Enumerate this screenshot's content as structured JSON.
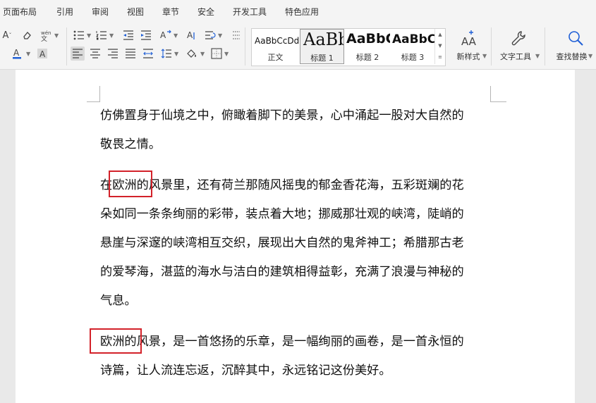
{
  "menu": [
    "页面布局",
    "引用",
    "审阅",
    "视图",
    "章节",
    "安全",
    "开发工具",
    "特色应用"
  ],
  "styles": [
    {
      "sample": "AaBbCcDd",
      "label": "正文"
    },
    {
      "sample": "AaBb",
      "label": "标题 1"
    },
    {
      "sample": "AaBbC",
      "label": "标题 2"
    },
    {
      "sample": "AaBbC",
      "label": "标题 3"
    }
  ],
  "tools": {
    "new_style": "新样式",
    "text_tools": "文字工具",
    "find_replace": "查找替换"
  },
  "document": {
    "paragraphs": [
      [
        "仿佛置身于仙境之中，俯瞰着脚下的美景，心中涌起一股对大自然的",
        "敬畏之情。"
      ],
      [
        "在欧洲的风景里，还有荷兰那随风摇曳的郁金香花海，五彩斑斓的花",
        "朵如同一条条绚丽的彩带，装点着大地；挪威那壮观的峡湾，陡峭的",
        "悬崖与深邃的峡湾相互交织，展现出大自然的鬼斧神工；希腊那古老",
        "的爱琴海，湛蓝的海水与洁白的建筑相得益彰，充满了浪漫与神秘的",
        "气息。"
      ],
      [
        "欧洲的风景，是一首悠扬的乐章，是一幅绚丽的画卷，是一首永恒的",
        "诗篇，让人流连忘返，沉醉其中，永远铭记这份美好。"
      ]
    ]
  }
}
